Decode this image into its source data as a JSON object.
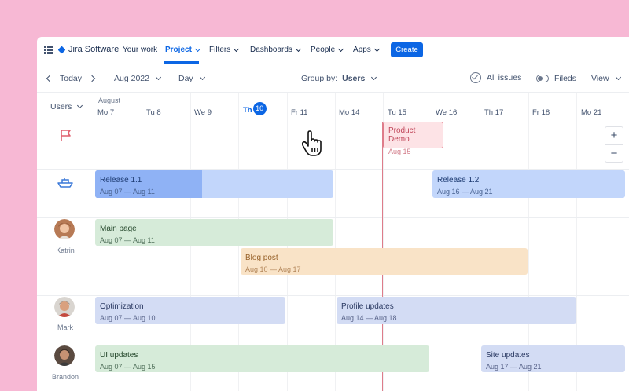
{
  "app": {
    "name": "Jira Software"
  },
  "nav": {
    "items": [
      {
        "label": "Your work",
        "dropdown": false
      },
      {
        "label": "Project",
        "dropdown": true,
        "active": true
      },
      {
        "label": "Filters",
        "dropdown": true
      },
      {
        "label": "Dashboards",
        "dropdown": true
      },
      {
        "label": "People",
        "dropdown": true
      },
      {
        "label": "Apps",
        "dropdown": true
      }
    ],
    "create_label": "Create"
  },
  "toolbar": {
    "today_label": "Today",
    "month_label": "Aug 2022",
    "view_scale": "Day",
    "group_by_label": "Group by:",
    "group_by_value": "Users",
    "all_issues_label": "All issues",
    "fileds_label": "Fileds",
    "view_label": "View"
  },
  "timeline": {
    "users_label": "Users",
    "month": "August",
    "days": [
      "Mo 7",
      "Tu 8",
      "We 9",
      "Th",
      "Fr 11",
      "Mo 14",
      "Tu 15",
      "We 16",
      "Th 17",
      "Fr 18",
      "Mo 21"
    ],
    "today_number": "10"
  },
  "milestone": {
    "title": "Product Demo",
    "date": "Aug 15"
  },
  "releases": [
    {
      "title": "Release 1.1",
      "dates": "Aug 07 — Aug 11",
      "progress": 0.45
    },
    {
      "title": "Release 1.2",
      "dates": "Aug 16 — Aug 21"
    }
  ],
  "users": [
    {
      "name": "Katrin",
      "tasks": [
        {
          "title": "Main page",
          "dates": "Aug 07 — Aug 11"
        },
        {
          "title": "Blog post",
          "dates": "Aug 10 — Aug 17"
        }
      ]
    },
    {
      "name": "Mark",
      "tasks": [
        {
          "title": "Optimization",
          "dates": "Aug 07 — Aug 10"
        },
        {
          "title": "Profile updates",
          "dates": "Aug 14 — Aug 18"
        }
      ]
    },
    {
      "name": "Brandon",
      "tasks": [
        {
          "title": "UI updates",
          "dates": "Aug 07 — Aug 15"
        },
        {
          "title": "Site updates",
          "dates": "Aug 17 — Aug 21"
        }
      ]
    }
  ],
  "zoom": {
    "in": "+",
    "out": "−"
  },
  "colors": {
    "accent": "#0c66e4",
    "background": "#f7b8d4",
    "milestone": "#e07b8a"
  }
}
